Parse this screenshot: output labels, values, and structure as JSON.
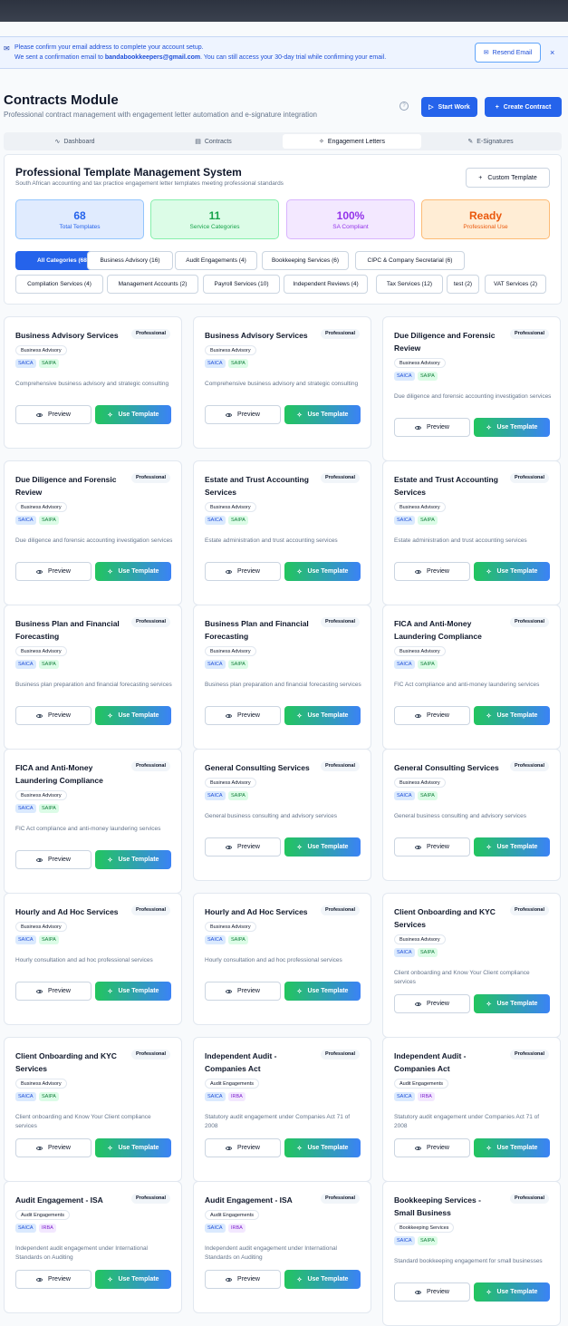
{
  "notice": {
    "line1": "Please confirm your email address to complete your account setup.",
    "line2_pre": "We sent a confirmation email to ",
    "email": "bandabookkeepers@gmail.com",
    "line2_post": ". You can still access your 30-day trial while confirming your email.",
    "resend_label": "Resend Email",
    "close_glyph": "×"
  },
  "header": {
    "title": "Contracts Module",
    "subtitle": "Professional contract management with engagement letter automation and e-signature integration",
    "start_work_label": "Start Work",
    "create_contract_label": "Create Contract"
  },
  "tabs": [
    {
      "label": "Dashboard",
      "icon": "activity-icon",
      "glyph": "∿"
    },
    {
      "label": "Contracts",
      "icon": "file-icon",
      "glyph": "▤"
    },
    {
      "label": "Engagement Letters",
      "icon": "sparkle-icon",
      "glyph": "✧"
    },
    {
      "label": "E-Signatures",
      "icon": "pen-icon",
      "glyph": "✎"
    }
  ],
  "panel": {
    "title": "Professional Template Management System",
    "subtitle": "South African accounting and tax practice engagement letter templates meeting professional standards",
    "custom_label": "Custom Template"
  },
  "stats": [
    {
      "value": "68",
      "label": "Total Templates",
      "bg": "#e0ebfe",
      "border": "#93c5fd",
      "color": "#2563eb"
    },
    {
      "value": "11",
      "label": "Service Categories",
      "bg": "#dcfce7",
      "border": "#86efac",
      "color": "#16a34a"
    },
    {
      "value": "100%",
      "label": "SA Compliant",
      "bg": "#f3e8ff",
      "border": "#d8b4fe",
      "color": "#9333ea"
    },
    {
      "value": "Ready",
      "label": "Professional Use",
      "bg": "#ffedd5",
      "border": "#fdba74",
      "color": "#ea580c"
    }
  ],
  "filters": [
    "All Categories (68)",
    "Business Advisory (16)",
    "Audit Engagements (4)",
    "Bookkeeping Services (6)",
    "CIPC & Company Secretarial (6)",
    "Compilation Services (4)",
    "Management Accounts (2)",
    "Payroll Services (10)",
    "Independent Reviews (4)",
    "Tax Services (12)",
    "test (2)",
    "VAT Services (2)"
  ],
  "card_common": {
    "professional_label": "Professional",
    "preview_label": "Preview",
    "use_label": "Use Template"
  },
  "cards": [
    {
      "title": "Business Advisory Services",
      "category": "Business Advisory",
      "badges": [
        "SAICA",
        "SAIPA"
      ],
      "desc": "Comprehensive business advisory and strategic consulting"
    },
    {
      "title": "Business Advisory Services",
      "category": "Business Advisory",
      "badges": [
        "SAICA",
        "SAIPA"
      ],
      "desc": "Comprehensive business advisory and strategic consulting"
    },
    {
      "title": "Due Diligence and Forensic Review",
      "category": "Business Advisory",
      "badges": [
        "SAICA",
        "SAIPA"
      ],
      "desc": "Due diligence and forensic accounting investigation services"
    },
    {
      "title": "Due Diligence and Forensic Review",
      "category": "Business Advisory",
      "badges": [
        "SAICA",
        "SAIPA"
      ],
      "desc": "Due diligence and forensic accounting investigation services"
    },
    {
      "title": "Estate and Trust Accounting Services",
      "category": "Business Advisory",
      "badges": [
        "SAICA",
        "SAIPA"
      ],
      "desc": "Estate administration and trust accounting services"
    },
    {
      "title": "Estate and Trust Accounting Services",
      "category": "Business Advisory",
      "badges": [
        "SAICA",
        "SAIPA"
      ],
      "desc": "Estate administration and trust accounting services"
    },
    {
      "title": "Business Plan and Financial Forecasting",
      "category": "Business Advisory",
      "badges": [
        "SAICA",
        "SAIPA"
      ],
      "desc": "Business plan preparation and financial forecasting services"
    },
    {
      "title": "Business Plan and Financial Forecasting",
      "category": "Business Advisory",
      "badges": [
        "SAICA",
        "SAIPA"
      ],
      "desc": "Business plan preparation and financial forecasting services"
    },
    {
      "title": "FICA and Anti-Money Laundering Compliance",
      "category": "Business Advisory",
      "badges": [
        "SAICA",
        "SAIPA"
      ],
      "desc": "FIC Act compliance and anti-money laundering services"
    },
    {
      "title": "FICA and Anti-Money Laundering Compliance",
      "category": "Business Advisory",
      "badges": [
        "SAICA",
        "SAIPA"
      ],
      "desc": "FIC Act compliance and anti-money laundering services"
    },
    {
      "title": "General Consulting Services",
      "category": "Business Advisory",
      "badges": [
        "SAICA",
        "SAIPA"
      ],
      "desc": "General business consulting and advisory services"
    },
    {
      "title": "General Consulting Services",
      "category": "Business Advisory",
      "badges": [
        "SAICA",
        "SAIPA"
      ],
      "desc": "General business consulting and advisory services"
    },
    {
      "title": "Hourly and Ad Hoc Services",
      "category": "Business Advisory",
      "badges": [
        "SAICA",
        "SAIPA"
      ],
      "desc": "Hourly consultation and ad hoc professional services"
    },
    {
      "title": "Hourly and Ad Hoc Services",
      "category": "Business Advisory",
      "badges": [
        "SAICA",
        "SAIPA"
      ],
      "desc": "Hourly consultation and ad hoc professional services"
    },
    {
      "title": "Client Onboarding and KYC Services",
      "category": "Business Advisory",
      "badges": [
        "SAICA",
        "SAIPA"
      ],
      "desc": "Client onboarding and Know Your Client compliance services"
    },
    {
      "title": "Client Onboarding and KYC Services",
      "category": "Business Advisory",
      "badges": [
        "SAICA",
        "SAIPA"
      ],
      "desc": "Client onboarding and Know Your Client compliance services"
    },
    {
      "title": "Independent Audit - Companies Act",
      "category": "Audit Engagements",
      "badges": [
        "SAICA",
        "IRBA"
      ],
      "desc": "Statutory audit engagement under Companies Act 71 of 2008"
    },
    {
      "title": "Independent Audit - Companies Act",
      "category": "Audit Engagements",
      "badges": [
        "SAICA",
        "IRBA"
      ],
      "desc": "Statutory audit engagement under Companies Act 71 of 2008"
    },
    {
      "title": "Audit Engagement - ISA",
      "category": "Audit Engagements",
      "badges": [
        "SAICA",
        "IRBA"
      ],
      "desc": "Independent audit engagement under International Standards on Auditing"
    },
    {
      "title": "Audit Engagement - ISA",
      "category": "Audit Engagements",
      "badges": [
        "SAICA",
        "IRBA"
      ],
      "desc": "Independent audit engagement under International Standards on Auditing"
    },
    {
      "title": "Bookkeeping Services - Small Business",
      "category": "Bookkeeping Services",
      "badges": [
        "SAICA",
        "SAIPA"
      ],
      "desc": "Standard bookkeeping engagement for small businesses"
    }
  ]
}
